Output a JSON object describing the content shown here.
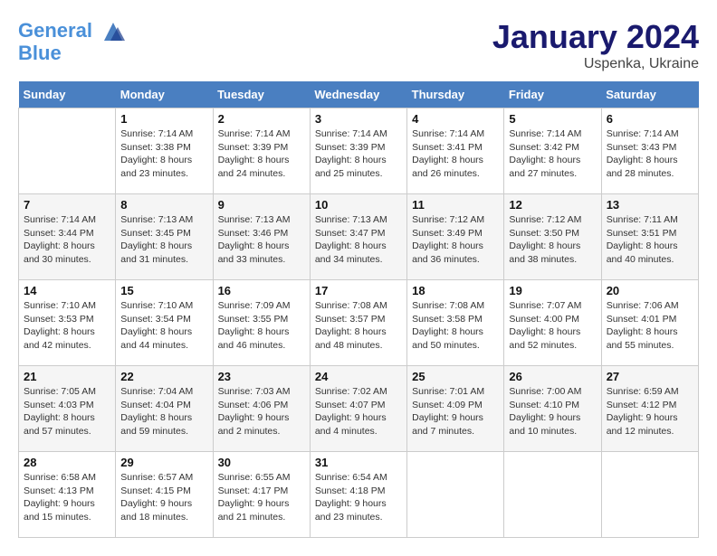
{
  "header": {
    "logo_line1": "General",
    "logo_line2": "Blue",
    "month_title": "January 2024",
    "location": "Uspenka, Ukraine"
  },
  "days_of_week": [
    "Sunday",
    "Monday",
    "Tuesday",
    "Wednesday",
    "Thursday",
    "Friday",
    "Saturday"
  ],
  "weeks": [
    [
      {
        "num": "",
        "data": ""
      },
      {
        "num": "1",
        "data": "Sunrise: 7:14 AM\nSunset: 3:38 PM\nDaylight: 8 hours\nand 23 minutes."
      },
      {
        "num": "2",
        "data": "Sunrise: 7:14 AM\nSunset: 3:39 PM\nDaylight: 8 hours\nand 24 minutes."
      },
      {
        "num": "3",
        "data": "Sunrise: 7:14 AM\nSunset: 3:39 PM\nDaylight: 8 hours\nand 25 minutes."
      },
      {
        "num": "4",
        "data": "Sunrise: 7:14 AM\nSunset: 3:41 PM\nDaylight: 8 hours\nand 26 minutes."
      },
      {
        "num": "5",
        "data": "Sunrise: 7:14 AM\nSunset: 3:42 PM\nDaylight: 8 hours\nand 27 minutes."
      },
      {
        "num": "6",
        "data": "Sunrise: 7:14 AM\nSunset: 3:43 PM\nDaylight: 8 hours\nand 28 minutes."
      }
    ],
    [
      {
        "num": "7",
        "data": "Sunrise: 7:14 AM\nSunset: 3:44 PM\nDaylight: 8 hours\nand 30 minutes."
      },
      {
        "num": "8",
        "data": "Sunrise: 7:13 AM\nSunset: 3:45 PM\nDaylight: 8 hours\nand 31 minutes."
      },
      {
        "num": "9",
        "data": "Sunrise: 7:13 AM\nSunset: 3:46 PM\nDaylight: 8 hours\nand 33 minutes."
      },
      {
        "num": "10",
        "data": "Sunrise: 7:13 AM\nSunset: 3:47 PM\nDaylight: 8 hours\nand 34 minutes."
      },
      {
        "num": "11",
        "data": "Sunrise: 7:12 AM\nSunset: 3:49 PM\nDaylight: 8 hours\nand 36 minutes."
      },
      {
        "num": "12",
        "data": "Sunrise: 7:12 AM\nSunset: 3:50 PM\nDaylight: 8 hours\nand 38 minutes."
      },
      {
        "num": "13",
        "data": "Sunrise: 7:11 AM\nSunset: 3:51 PM\nDaylight: 8 hours\nand 40 minutes."
      }
    ],
    [
      {
        "num": "14",
        "data": "Sunrise: 7:10 AM\nSunset: 3:53 PM\nDaylight: 8 hours\nand 42 minutes."
      },
      {
        "num": "15",
        "data": "Sunrise: 7:10 AM\nSunset: 3:54 PM\nDaylight: 8 hours\nand 44 minutes."
      },
      {
        "num": "16",
        "data": "Sunrise: 7:09 AM\nSunset: 3:55 PM\nDaylight: 8 hours\nand 46 minutes."
      },
      {
        "num": "17",
        "data": "Sunrise: 7:08 AM\nSunset: 3:57 PM\nDaylight: 8 hours\nand 48 minutes."
      },
      {
        "num": "18",
        "data": "Sunrise: 7:08 AM\nSunset: 3:58 PM\nDaylight: 8 hours\nand 50 minutes."
      },
      {
        "num": "19",
        "data": "Sunrise: 7:07 AM\nSunset: 4:00 PM\nDaylight: 8 hours\nand 52 minutes."
      },
      {
        "num": "20",
        "data": "Sunrise: 7:06 AM\nSunset: 4:01 PM\nDaylight: 8 hours\nand 55 minutes."
      }
    ],
    [
      {
        "num": "21",
        "data": "Sunrise: 7:05 AM\nSunset: 4:03 PM\nDaylight: 8 hours\nand 57 minutes."
      },
      {
        "num": "22",
        "data": "Sunrise: 7:04 AM\nSunset: 4:04 PM\nDaylight: 8 hours\nand 59 minutes."
      },
      {
        "num": "23",
        "data": "Sunrise: 7:03 AM\nSunset: 4:06 PM\nDaylight: 9 hours\nand 2 minutes."
      },
      {
        "num": "24",
        "data": "Sunrise: 7:02 AM\nSunset: 4:07 PM\nDaylight: 9 hours\nand 4 minutes."
      },
      {
        "num": "25",
        "data": "Sunrise: 7:01 AM\nSunset: 4:09 PM\nDaylight: 9 hours\nand 7 minutes."
      },
      {
        "num": "26",
        "data": "Sunrise: 7:00 AM\nSunset: 4:10 PM\nDaylight: 9 hours\nand 10 minutes."
      },
      {
        "num": "27",
        "data": "Sunrise: 6:59 AM\nSunset: 4:12 PM\nDaylight: 9 hours\nand 12 minutes."
      }
    ],
    [
      {
        "num": "28",
        "data": "Sunrise: 6:58 AM\nSunset: 4:13 PM\nDaylight: 9 hours\nand 15 minutes."
      },
      {
        "num": "29",
        "data": "Sunrise: 6:57 AM\nSunset: 4:15 PM\nDaylight: 9 hours\nand 18 minutes."
      },
      {
        "num": "30",
        "data": "Sunrise: 6:55 AM\nSunset: 4:17 PM\nDaylight: 9 hours\nand 21 minutes."
      },
      {
        "num": "31",
        "data": "Sunrise: 6:54 AM\nSunset: 4:18 PM\nDaylight: 9 hours\nand 23 minutes."
      },
      {
        "num": "",
        "data": ""
      },
      {
        "num": "",
        "data": ""
      },
      {
        "num": "",
        "data": ""
      }
    ]
  ]
}
